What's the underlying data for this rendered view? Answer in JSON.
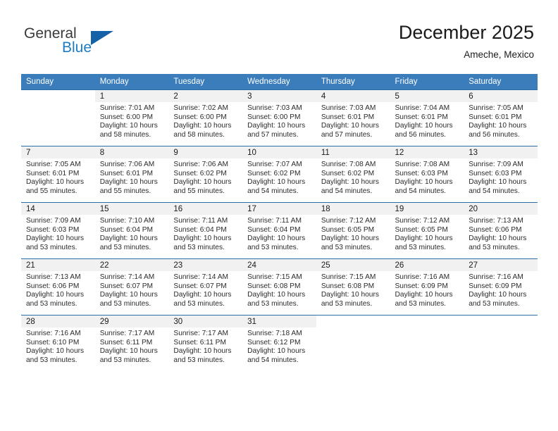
{
  "brand": {
    "name_line1": "General",
    "name_line2": "Blue",
    "accent_color": "#1c7cc4",
    "triangle_color": "#1461a8"
  },
  "header": {
    "title": "December 2025",
    "location": "Ameche, Mexico"
  },
  "calendar": {
    "header_bg": "#3a7dba",
    "weekdays": [
      "Sunday",
      "Monday",
      "Tuesday",
      "Wednesday",
      "Thursday",
      "Friday",
      "Saturday"
    ],
    "weeks": [
      [
        {
          "day": "",
          "sunrise": "",
          "sunset": "",
          "daylight1": "",
          "daylight2": ""
        },
        {
          "day": "1",
          "sunrise": "Sunrise: 7:01 AM",
          "sunset": "Sunset: 6:00 PM",
          "daylight1": "Daylight: 10 hours",
          "daylight2": "and 58 minutes."
        },
        {
          "day": "2",
          "sunrise": "Sunrise: 7:02 AM",
          "sunset": "Sunset: 6:00 PM",
          "daylight1": "Daylight: 10 hours",
          "daylight2": "and 58 minutes."
        },
        {
          "day": "3",
          "sunrise": "Sunrise: 7:03 AM",
          "sunset": "Sunset: 6:00 PM",
          "daylight1": "Daylight: 10 hours",
          "daylight2": "and 57 minutes."
        },
        {
          "day": "4",
          "sunrise": "Sunrise: 7:03 AM",
          "sunset": "Sunset: 6:01 PM",
          "daylight1": "Daylight: 10 hours",
          "daylight2": "and 57 minutes."
        },
        {
          "day": "5",
          "sunrise": "Sunrise: 7:04 AM",
          "sunset": "Sunset: 6:01 PM",
          "daylight1": "Daylight: 10 hours",
          "daylight2": "and 56 minutes."
        },
        {
          "day": "6",
          "sunrise": "Sunrise: 7:05 AM",
          "sunset": "Sunset: 6:01 PM",
          "daylight1": "Daylight: 10 hours",
          "daylight2": "and 56 minutes."
        }
      ],
      [
        {
          "day": "7",
          "sunrise": "Sunrise: 7:05 AM",
          "sunset": "Sunset: 6:01 PM",
          "daylight1": "Daylight: 10 hours",
          "daylight2": "and 55 minutes."
        },
        {
          "day": "8",
          "sunrise": "Sunrise: 7:06 AM",
          "sunset": "Sunset: 6:01 PM",
          "daylight1": "Daylight: 10 hours",
          "daylight2": "and 55 minutes."
        },
        {
          "day": "9",
          "sunrise": "Sunrise: 7:06 AM",
          "sunset": "Sunset: 6:02 PM",
          "daylight1": "Daylight: 10 hours",
          "daylight2": "and 55 minutes."
        },
        {
          "day": "10",
          "sunrise": "Sunrise: 7:07 AM",
          "sunset": "Sunset: 6:02 PM",
          "daylight1": "Daylight: 10 hours",
          "daylight2": "and 54 minutes."
        },
        {
          "day": "11",
          "sunrise": "Sunrise: 7:08 AM",
          "sunset": "Sunset: 6:02 PM",
          "daylight1": "Daylight: 10 hours",
          "daylight2": "and 54 minutes."
        },
        {
          "day": "12",
          "sunrise": "Sunrise: 7:08 AM",
          "sunset": "Sunset: 6:03 PM",
          "daylight1": "Daylight: 10 hours",
          "daylight2": "and 54 minutes."
        },
        {
          "day": "13",
          "sunrise": "Sunrise: 7:09 AM",
          "sunset": "Sunset: 6:03 PM",
          "daylight1": "Daylight: 10 hours",
          "daylight2": "and 54 minutes."
        }
      ],
      [
        {
          "day": "14",
          "sunrise": "Sunrise: 7:09 AM",
          "sunset": "Sunset: 6:03 PM",
          "daylight1": "Daylight: 10 hours",
          "daylight2": "and 53 minutes."
        },
        {
          "day": "15",
          "sunrise": "Sunrise: 7:10 AM",
          "sunset": "Sunset: 6:04 PM",
          "daylight1": "Daylight: 10 hours",
          "daylight2": "and 53 minutes."
        },
        {
          "day": "16",
          "sunrise": "Sunrise: 7:11 AM",
          "sunset": "Sunset: 6:04 PM",
          "daylight1": "Daylight: 10 hours",
          "daylight2": "and 53 minutes."
        },
        {
          "day": "17",
          "sunrise": "Sunrise: 7:11 AM",
          "sunset": "Sunset: 6:04 PM",
          "daylight1": "Daylight: 10 hours",
          "daylight2": "and 53 minutes."
        },
        {
          "day": "18",
          "sunrise": "Sunrise: 7:12 AM",
          "sunset": "Sunset: 6:05 PM",
          "daylight1": "Daylight: 10 hours",
          "daylight2": "and 53 minutes."
        },
        {
          "day": "19",
          "sunrise": "Sunrise: 7:12 AM",
          "sunset": "Sunset: 6:05 PM",
          "daylight1": "Daylight: 10 hours",
          "daylight2": "and 53 minutes."
        },
        {
          "day": "20",
          "sunrise": "Sunrise: 7:13 AM",
          "sunset": "Sunset: 6:06 PM",
          "daylight1": "Daylight: 10 hours",
          "daylight2": "and 53 minutes."
        }
      ],
      [
        {
          "day": "21",
          "sunrise": "Sunrise: 7:13 AM",
          "sunset": "Sunset: 6:06 PM",
          "daylight1": "Daylight: 10 hours",
          "daylight2": "and 53 minutes."
        },
        {
          "day": "22",
          "sunrise": "Sunrise: 7:14 AM",
          "sunset": "Sunset: 6:07 PM",
          "daylight1": "Daylight: 10 hours",
          "daylight2": "and 53 minutes."
        },
        {
          "day": "23",
          "sunrise": "Sunrise: 7:14 AM",
          "sunset": "Sunset: 6:07 PM",
          "daylight1": "Daylight: 10 hours",
          "daylight2": "and 53 minutes."
        },
        {
          "day": "24",
          "sunrise": "Sunrise: 7:15 AM",
          "sunset": "Sunset: 6:08 PM",
          "daylight1": "Daylight: 10 hours",
          "daylight2": "and 53 minutes."
        },
        {
          "day": "25",
          "sunrise": "Sunrise: 7:15 AM",
          "sunset": "Sunset: 6:08 PM",
          "daylight1": "Daylight: 10 hours",
          "daylight2": "and 53 minutes."
        },
        {
          "day": "26",
          "sunrise": "Sunrise: 7:16 AM",
          "sunset": "Sunset: 6:09 PM",
          "daylight1": "Daylight: 10 hours",
          "daylight2": "and 53 minutes."
        },
        {
          "day": "27",
          "sunrise": "Sunrise: 7:16 AM",
          "sunset": "Sunset: 6:09 PM",
          "daylight1": "Daylight: 10 hours",
          "daylight2": "and 53 minutes."
        }
      ],
      [
        {
          "day": "28",
          "sunrise": "Sunrise: 7:16 AM",
          "sunset": "Sunset: 6:10 PM",
          "daylight1": "Daylight: 10 hours",
          "daylight2": "and 53 minutes."
        },
        {
          "day": "29",
          "sunrise": "Sunrise: 7:17 AM",
          "sunset": "Sunset: 6:11 PM",
          "daylight1": "Daylight: 10 hours",
          "daylight2": "and 53 minutes."
        },
        {
          "day": "30",
          "sunrise": "Sunrise: 7:17 AM",
          "sunset": "Sunset: 6:11 PM",
          "daylight1": "Daylight: 10 hours",
          "daylight2": "and 53 minutes."
        },
        {
          "day": "31",
          "sunrise": "Sunrise: 7:18 AM",
          "sunset": "Sunset: 6:12 PM",
          "daylight1": "Daylight: 10 hours",
          "daylight2": "and 54 minutes."
        },
        {
          "day": "",
          "sunrise": "",
          "sunset": "",
          "daylight1": "",
          "daylight2": ""
        },
        {
          "day": "",
          "sunrise": "",
          "sunset": "",
          "daylight1": "",
          "daylight2": ""
        },
        {
          "day": "",
          "sunrise": "",
          "sunset": "",
          "daylight1": "",
          "daylight2": ""
        }
      ]
    ]
  }
}
